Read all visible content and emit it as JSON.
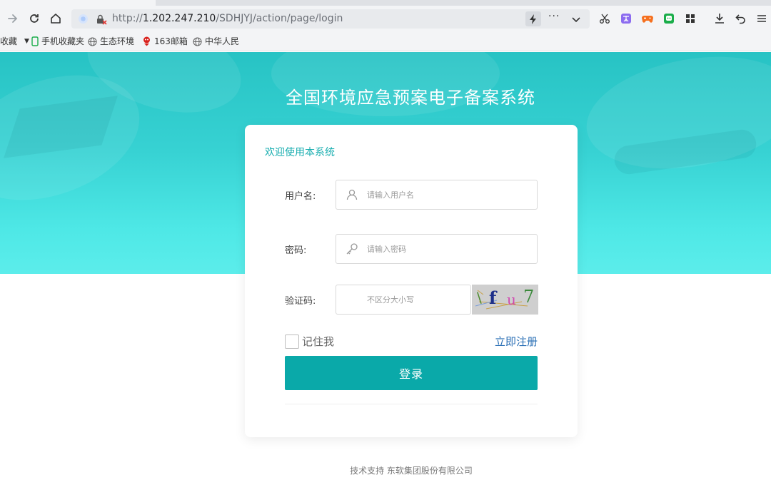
{
  "browser": {
    "url_prefix": "http://",
    "url_host": "1.202.247.210",
    "url_path": "/SDHJYJ/action/page/login",
    "more_label": "···",
    "bookmarks": [
      {
        "label": "收藏",
        "icon": "none"
      },
      {
        "label": "手机收藏夹",
        "icon": "phone-icon"
      },
      {
        "label": "生态环境",
        "icon": "globe-icon"
      },
      {
        "label": "163邮箱",
        "icon": "mail-icon"
      },
      {
        "label": "中华人民",
        "icon": "globe-icon"
      }
    ]
  },
  "page": {
    "title": "全国环境应急预案电子备案系统",
    "welcome": "欢迎使用本系统",
    "username": {
      "label": "用户名:",
      "placeholder": "请输入用户名",
      "value": ""
    },
    "password": {
      "label": "密码:",
      "placeholder": "请输入密码",
      "value": ""
    },
    "captcha": {
      "label": "验证码:",
      "placeholder": "不区分大小写",
      "value": "",
      "image_text": [
        "\\",
        "f",
        "u",
        "7"
      ]
    },
    "remember_label": "记住我",
    "register_label": "立即注册",
    "login_label": "登录",
    "footer": "技术支持 东软集团股份有限公司"
  },
  "colors": {
    "accent": "#0aa9a9",
    "hero_top": "#27c3c4",
    "hero_bottom": "#5cedeb",
    "link": "#2a6fb5"
  }
}
